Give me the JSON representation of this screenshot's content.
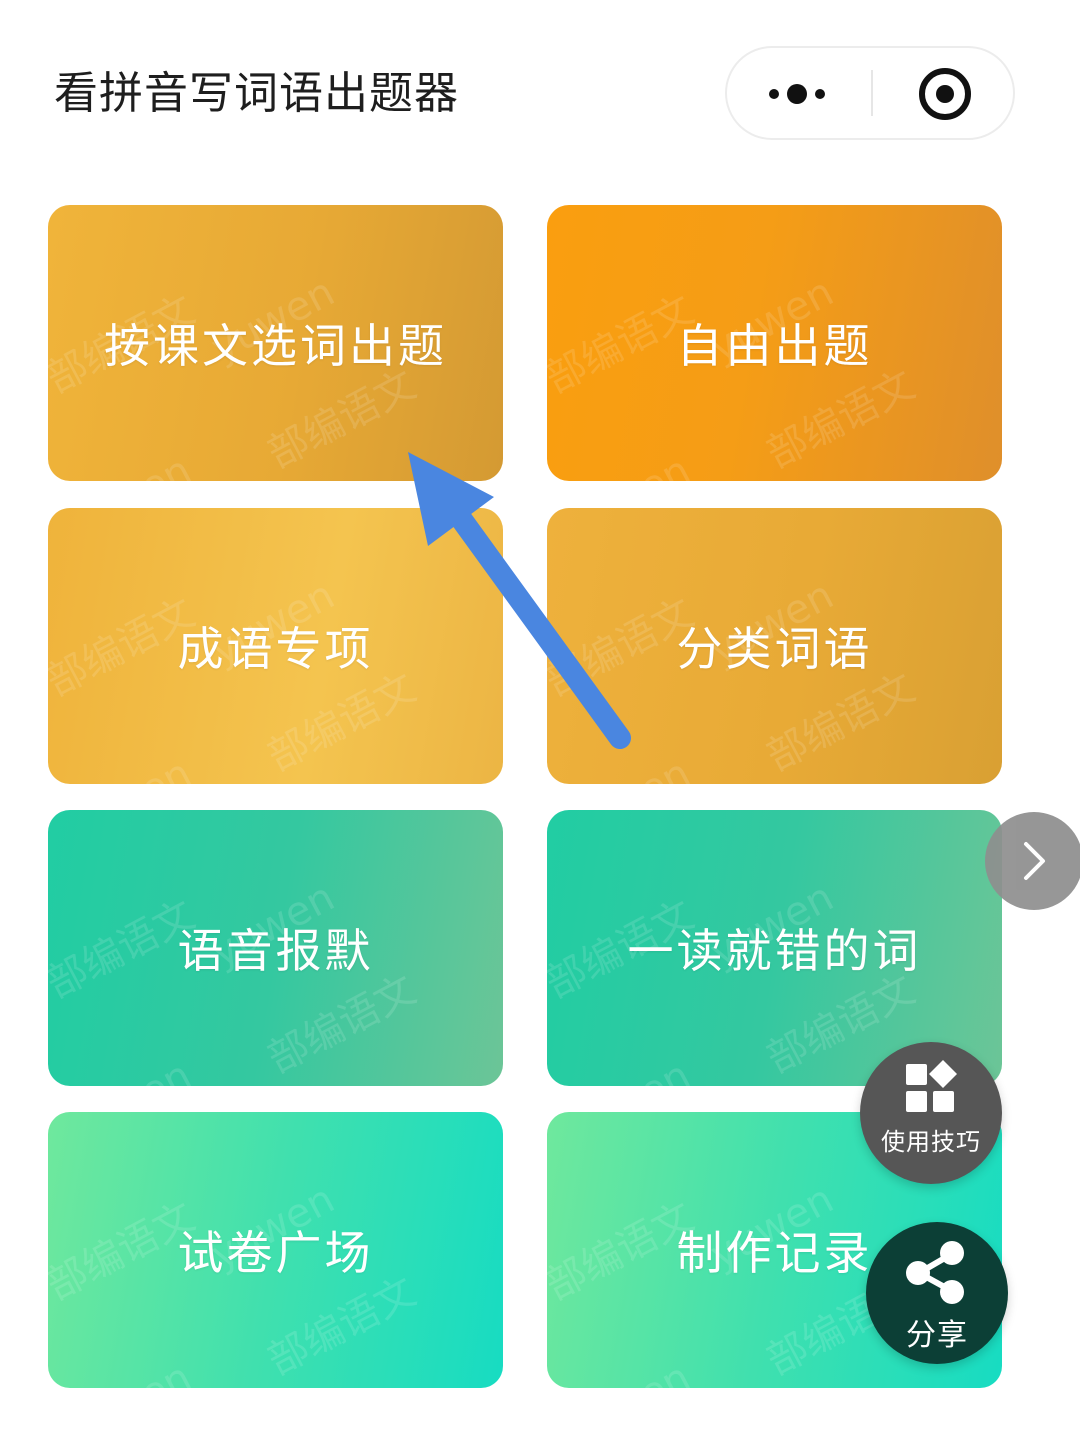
{
  "header": {
    "title": "看拼音写词语出题器"
  },
  "capsule": {
    "more_icon": "more-dots-icon",
    "close_icon": "target-close-icon"
  },
  "cards": [
    {
      "label": "按课文选词出题"
    },
    {
      "label": "自由出题"
    },
    {
      "label": "成语专项"
    },
    {
      "label": "分类词语"
    },
    {
      "label": "语音报默"
    },
    {
      "label": "一读就错的词"
    },
    {
      "label": "试卷广场"
    },
    {
      "label": "制作记录"
    }
  ],
  "watermark": {
    "text_cn": "部编语文",
    "text_en": "yuwen"
  },
  "fabs": {
    "tips": {
      "label": "使用技巧",
      "icon": "grid-shapes-icon"
    },
    "share": {
      "label": "分享",
      "icon": "share-icon"
    }
  },
  "colors": {
    "arrow": "#4a86e0",
    "orange": "#f59d16",
    "yellow": "#e9ad38",
    "teal": "#2fcaa1",
    "mint": "#3fe0ae"
  }
}
